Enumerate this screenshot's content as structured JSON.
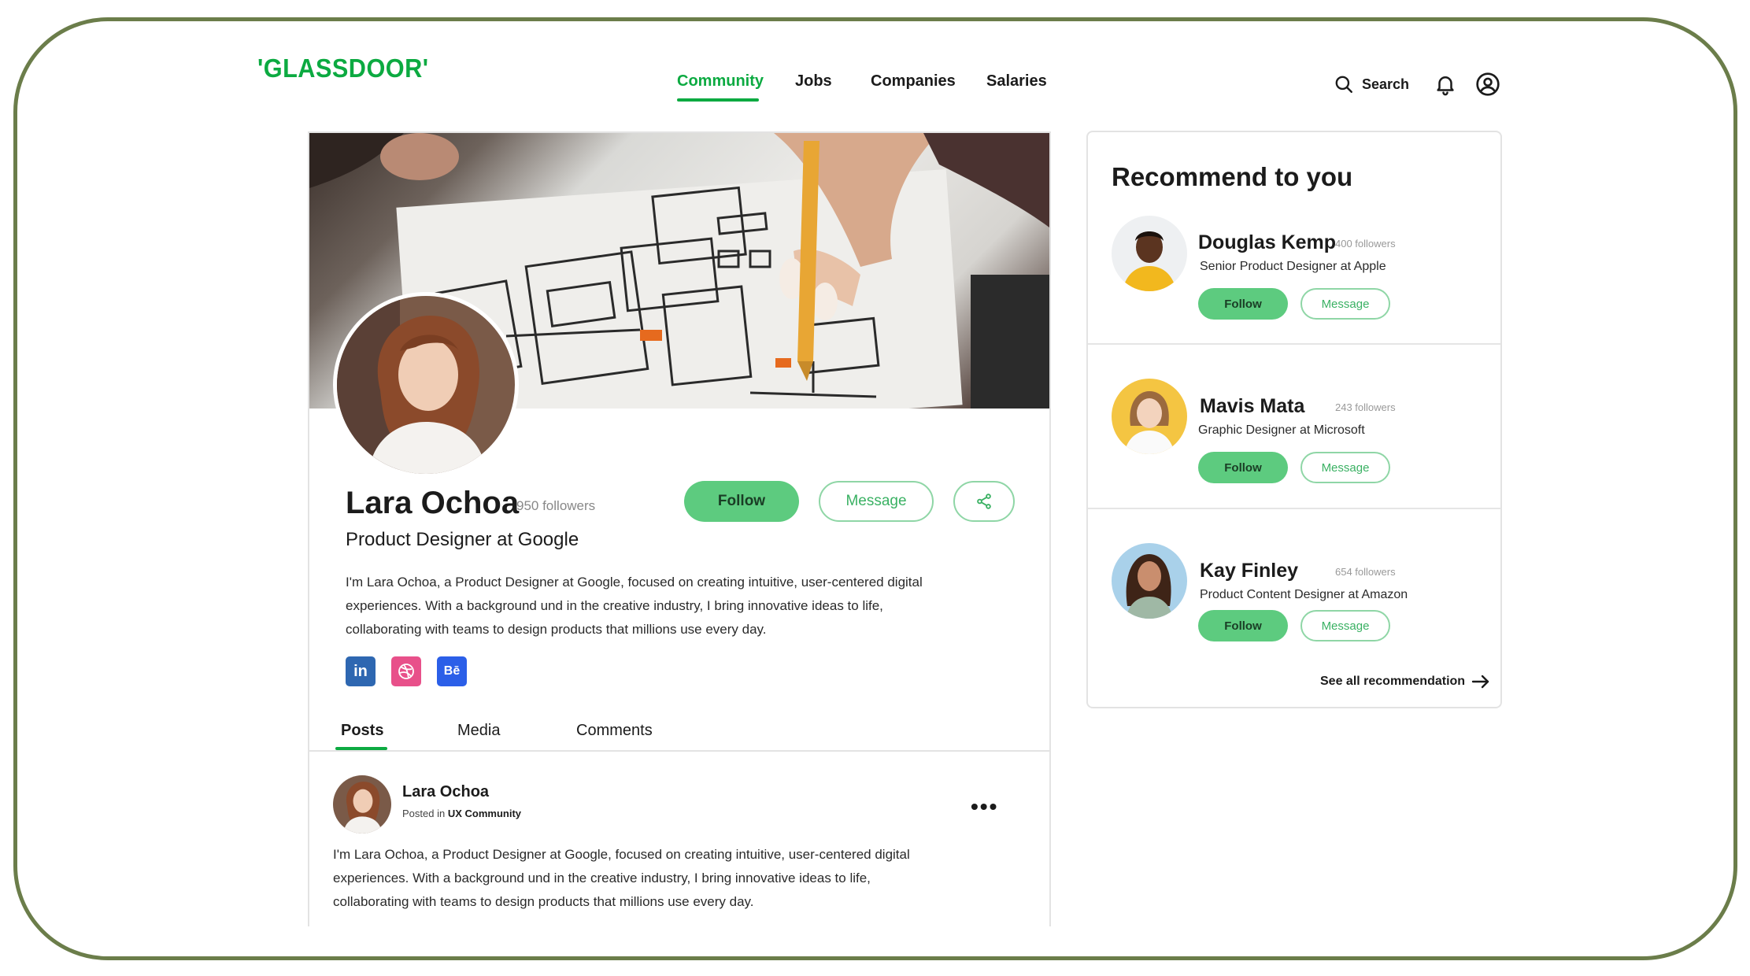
{
  "brand": {
    "logo_text": "'GLASSDOOR'",
    "accent_color": "#0caa41",
    "frame_color": "#6b7d4a"
  },
  "nav": {
    "links": [
      {
        "label": "Community",
        "active": true
      },
      {
        "label": "Jobs",
        "active": false
      },
      {
        "label": "Companies",
        "active": false
      },
      {
        "label": "Salaries",
        "active": false
      }
    ],
    "search_label": "Search",
    "icons": [
      "search-icon",
      "bell-icon",
      "user-circle-icon"
    ]
  },
  "profile": {
    "name": "Lara Ochoa",
    "followers": "950 followers",
    "role": "Product Designer at Google",
    "bio": "I'm Lara Ochoa, a Product Designer at Google, focused on creating intuitive, user-centered digital experiences. With a background und in the creative industry, I bring innovative ideas to life, collaborating with teams to design products that millions use every day.",
    "follow_label": "Follow",
    "message_label": "Message",
    "share_icon": "share-icon",
    "socials": [
      {
        "name": "linkedin",
        "glyph": "in",
        "color": "#2e67b1"
      },
      {
        "name": "dribbble",
        "glyph": "",
        "color": "#e8508a"
      },
      {
        "name": "behance",
        "glyph": "Bē",
        "color": "#2b5fe8"
      }
    ]
  },
  "tabs": [
    {
      "label": "Posts",
      "active": true
    },
    {
      "label": "Media",
      "active": false
    },
    {
      "label": "Comments",
      "active": false
    }
  ],
  "post": {
    "author": "Lara Ochoa",
    "posted_in_prefix": "Posted in",
    "community": "UX Community",
    "more": "•••",
    "body": "I'm Lara Ochoa, a Product Designer at Google, focused on creating intuitive, user-centered digital experiences. With a background und in the creative industry, I bring innovative ideas to life, collaborating with teams to design products that millions use every day."
  },
  "recommendations": {
    "title": "Recommend to you",
    "see_all": "See all recommendation",
    "items": [
      {
        "name": "Douglas Kemp",
        "followers": "400 followers",
        "role": "Senior Product Designer at Apple",
        "follow_label": "Follow",
        "message_label": "Message"
      },
      {
        "name": "Mavis Mata",
        "followers": "243 followers",
        "role": "Graphic Designer at Microsoft",
        "follow_label": "Follow",
        "message_label": "Message"
      },
      {
        "name": "Kay Finley",
        "followers": "654 followers",
        "role": "Product Content Designer at Amazon",
        "follow_label": "Follow",
        "message_label": "Message"
      }
    ]
  }
}
